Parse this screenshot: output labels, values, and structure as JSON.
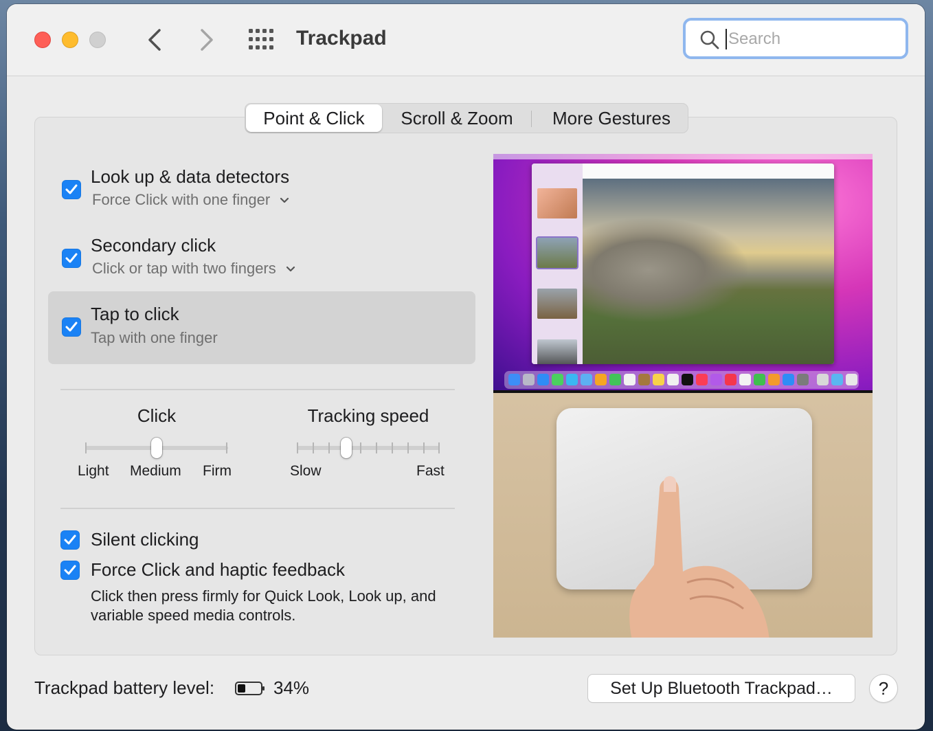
{
  "window": {
    "title": "Trackpad"
  },
  "search": {
    "placeholder": "Search",
    "value": ""
  },
  "tabs": [
    {
      "label": "Point & Click",
      "selected": true
    },
    {
      "label": "Scroll & Zoom",
      "selected": false
    },
    {
      "label": "More Gestures",
      "selected": false
    }
  ],
  "options": [
    {
      "title": "Look up & data detectors",
      "subtitle": "Force Click with one finger",
      "checked": true,
      "has_dropdown": true
    },
    {
      "title": "Secondary click",
      "subtitle": "Click or tap with two fingers",
      "checked": true,
      "has_dropdown": true
    },
    {
      "title": "Tap to click",
      "subtitle": "Tap with one finger",
      "checked": true,
      "has_dropdown": false,
      "highlighted": true
    }
  ],
  "click_slider": {
    "title": "Click",
    "labels": [
      "Light",
      "Medium",
      "Firm"
    ],
    "value": "Medium",
    "position": 0.5
  },
  "tracking_slider": {
    "title": "Tracking speed",
    "min_label": "Slow",
    "max_label": "Fast",
    "ticks": 10,
    "position": 0.3333
  },
  "silent_clicking": {
    "label": "Silent clicking",
    "checked": true
  },
  "force_click": {
    "label": "Force Click and haptic feedback",
    "checked": true,
    "description": "Click then press firmly for Quick Look, Look up, and variable speed media controls."
  },
  "battery": {
    "label": "Trackpad battery level:",
    "percent_text": "34%",
    "level": 0.34
  },
  "buttons": {
    "setup": "Set Up Bluetooth Trackpad…",
    "help": "?"
  },
  "colors": {
    "accent": "#1a82f5",
    "close": "#fe5f57",
    "minimize": "#febc2e",
    "search_focus": "#8fb7ee"
  },
  "icons": [
    "close-icon",
    "minimize-icon",
    "zoom-icon",
    "back-icon",
    "forward-icon",
    "grid-icon",
    "search-icon",
    "checkmark-icon",
    "chevron-down-icon",
    "battery-icon",
    "help-icon"
  ]
}
